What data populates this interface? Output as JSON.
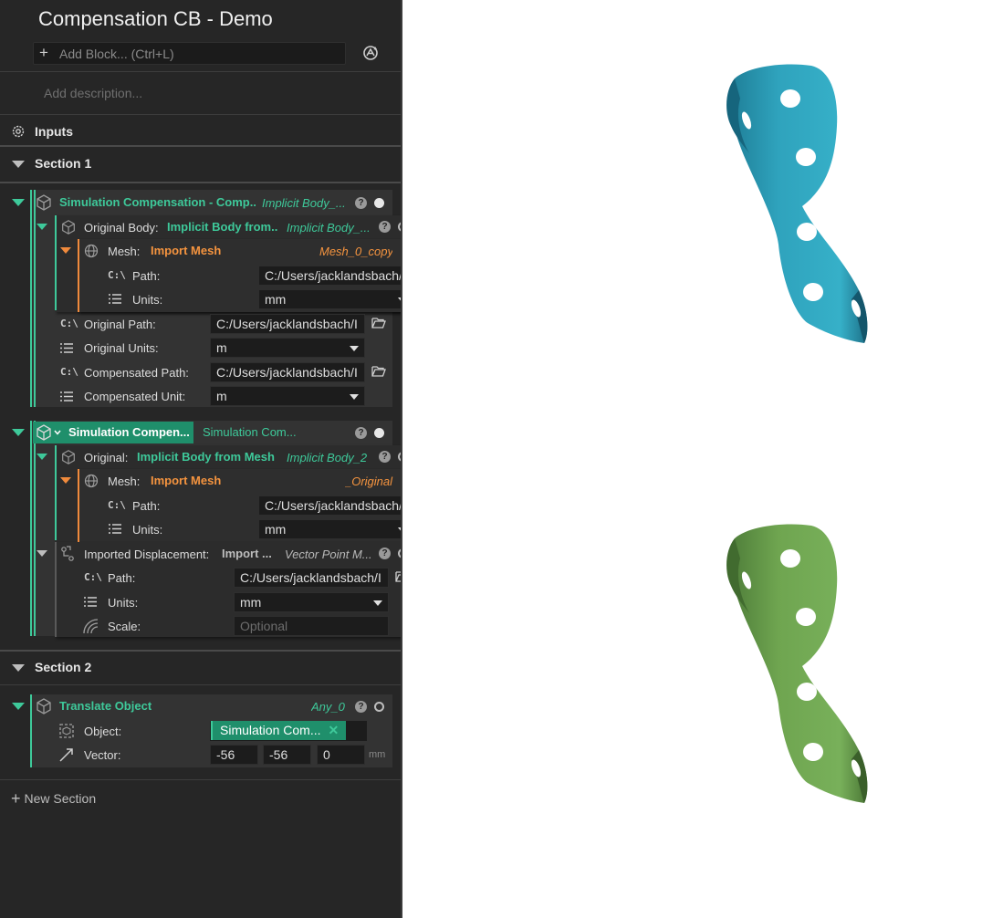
{
  "header": {
    "title": "Compensation CB - Demo",
    "add_block_placeholder": "Add Block... (Ctrl+L)",
    "description_placeholder": "Add description..."
  },
  "inputs_label": "Inputs",
  "sections": [
    {
      "label": "Section 1",
      "blocks": [
        {
          "title": "Simulation Compensation - Comp...",
          "output": "Implicit Body_...",
          "original_body": {
            "label": "Original Body:",
            "value": "Implicit Body from...",
            "output": "Implicit Body_...",
            "mesh": {
              "label": "Mesh:",
              "value": "Import Mesh",
              "output": "Mesh_0_copy",
              "path_label": "Path:",
              "path_value": "C:/Users/jacklandsbach/I",
              "units_label": "Units:",
              "units_value": "mm"
            }
          },
          "original_path_label": "Original Path:",
          "original_path_value": "C:/Users/jacklandsbach/I",
          "original_units_label": "Original Units:",
          "original_units_value": "m",
          "compensated_path_label": "Compensated Path:",
          "compensated_path_value": "C:/Users/jacklandsbach/I",
          "compensated_unit_label": "Compensated Unit:",
          "compensated_unit_value": "m"
        },
        {
          "title": "Simulation Compen...",
          "output": "Simulation Com...",
          "original": {
            "label": "Original:",
            "value": "Implicit Body from Mesh",
            "output": "Implicit Body_2",
            "mesh": {
              "label": "Mesh:",
              "value": "Import Mesh",
              "output": "_Original",
              "path_label": "Path:",
              "path_value": "C:/Users/jacklandsbach/I",
              "units_label": "Units:",
              "units_value": "mm"
            }
          },
          "displacement": {
            "label": "Imported Displacement:",
            "value": "Import ...",
            "output": "Vector Point M...",
            "path_label": "Path:",
            "path_value": "C:/Users/jacklandsbach/I",
            "units_label": "Units:",
            "units_value": "mm",
            "scale_label": "Scale:",
            "scale_placeholder": "Optional"
          }
        }
      ]
    },
    {
      "label": "Section 2",
      "blocks": [
        {
          "title": "Translate Object",
          "output": "Any_0",
          "object_label": "Object:",
          "object_value": "Simulation Com...",
          "vector_label": "Vector:",
          "vector": [
            "-56",
            "-56",
            "0"
          ],
          "vector_unit": "mm"
        }
      ]
    }
  ],
  "new_section_label": "New Section",
  "path_icon_text": "C:\\",
  "help_text": "?",
  "colors": {
    "panel_bg": "#262626",
    "accent_green": "#3ec99a",
    "accent_orange": "#f5943f",
    "warning_yellow": "#f2c518",
    "model_blue": "#2e9fb8",
    "model_green": "#6fa550"
  }
}
